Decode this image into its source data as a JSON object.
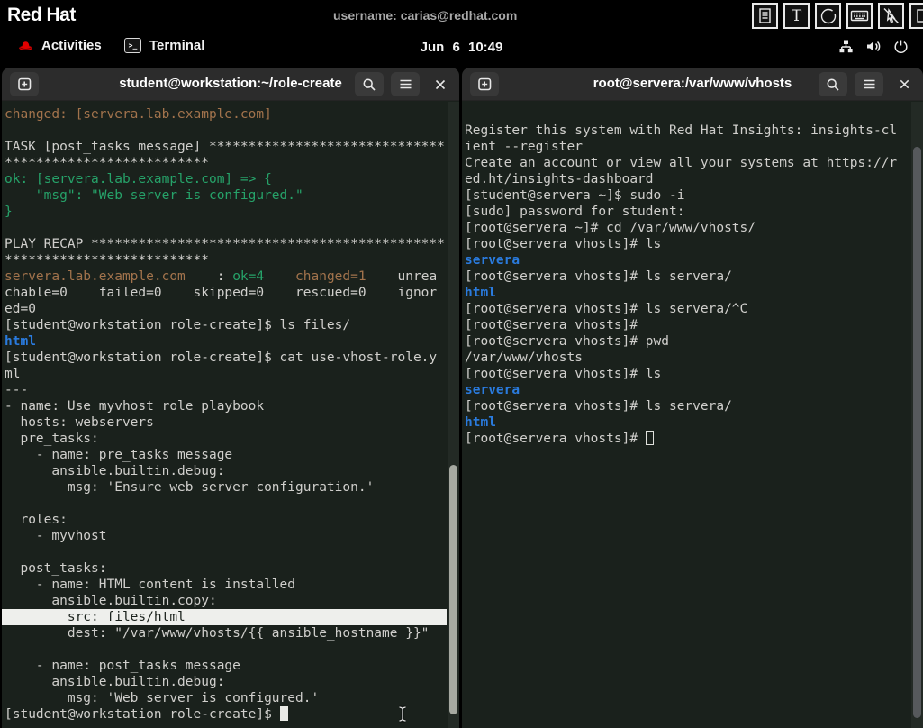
{
  "colors": {
    "terminal_bg": "#1a211c",
    "fg": "#d0cfcc",
    "yellow": "#a2734c",
    "green": "#26a269",
    "blue": "#2a7bde",
    "selection_bg": "#eeefec",
    "selection_fg": "#1a211c",
    "headerbar_bg": "#2c2c2c",
    "topbar_bg": "#000000",
    "redhat_red": "#ee0000"
  },
  "top_bar": {
    "logo": "Red Hat",
    "username": "username: carias@redhat.com",
    "tool_icons": [
      "document-icon",
      "text-icon",
      "circle-icon",
      "keyboard-icon",
      "pointer-disabled-icon",
      "monitor-icon"
    ]
  },
  "gnome_bar": {
    "activities_label": "Activities",
    "app_label": "Terminal",
    "clock": "Jun 6 10:49",
    "status_icons": [
      "network-icon",
      "volume-icon",
      "power-icon"
    ]
  },
  "window_controls": [
    "tab-new-icon",
    "search-icon",
    "menu-icon",
    "close-icon"
  ],
  "left_terminal": {
    "title": "student@workstation:~/role-create",
    "cursor_style": "block",
    "lines": [
      {
        "s": [
          {
            "t": "changed: [servera.lab.example.com]",
            "c": "yellow"
          }
        ]
      },
      {
        "s": []
      },
      {
        "s": [
          {
            "t": "TASK [post_tasks message] ******************************"
          }
        ]
      },
      {
        "s": [
          {
            "t": "**************************"
          }
        ]
      },
      {
        "s": [
          {
            "t": "ok: [servera.lab.example.com] => {",
            "c": "green"
          }
        ]
      },
      {
        "s": [
          {
            "t": "    \"msg\": \"Web server is configured.\"",
            "c": "green"
          }
        ]
      },
      {
        "s": [
          {
            "t": "}",
            "c": "green"
          }
        ]
      },
      {
        "s": []
      },
      {
        "s": [
          {
            "t": "PLAY RECAP *********************************************"
          }
        ]
      },
      {
        "s": [
          {
            "t": "**************************"
          }
        ]
      },
      {
        "s": [
          {
            "t": "servera.lab.example.com",
            "c": "yellow"
          },
          {
            "t": "    : "
          },
          {
            "t": "ok=4",
            "c": "green"
          },
          {
            "t": "    "
          },
          {
            "t": "changed=1",
            "c": "yellow"
          },
          {
            "t": "    unrea"
          }
        ]
      },
      {
        "s": [
          {
            "t": "chable=0    failed=0    skipped=0    rescued=0    ignor"
          }
        ]
      },
      {
        "s": [
          {
            "t": "ed=0"
          }
        ]
      },
      {
        "s": [
          {
            "t": "[student@workstation role-create]$ ls files/"
          }
        ]
      },
      {
        "s": [
          {
            "t": "html",
            "c": "blue"
          }
        ]
      },
      {
        "s": [
          {
            "t": "[student@workstation role-create]$ cat use-vhost-role.y"
          }
        ]
      },
      {
        "s": [
          {
            "t": "ml"
          }
        ]
      },
      {
        "s": [
          {
            "t": "---"
          }
        ]
      },
      {
        "s": [
          {
            "t": "- name: Use myvhost role playbook"
          }
        ]
      },
      {
        "s": [
          {
            "t": "  hosts: webservers"
          }
        ]
      },
      {
        "s": [
          {
            "t": "  pre_tasks:"
          }
        ]
      },
      {
        "s": [
          {
            "t": "    - name: pre_tasks message"
          }
        ]
      },
      {
        "s": [
          {
            "t": "      ansible.builtin.debug:"
          }
        ]
      },
      {
        "s": [
          {
            "t": "        msg: 'Ensure web server configuration.'"
          }
        ]
      },
      {
        "s": []
      },
      {
        "s": [
          {
            "t": "  roles:"
          }
        ]
      },
      {
        "s": [
          {
            "t": "    - myvhost"
          }
        ]
      },
      {
        "s": []
      },
      {
        "s": [
          {
            "t": "  post_tasks:"
          }
        ]
      },
      {
        "s": [
          {
            "t": "    - name: HTML content is installed"
          }
        ]
      },
      {
        "s": [
          {
            "t": "      ansible.builtin.copy:"
          }
        ]
      },
      {
        "s": [
          {
            "t": "        src: files/html"
          }
        ],
        "sel": true
      },
      {
        "s": [
          {
            "t": "        dest: \"/var/www/vhosts/{{ ansible_hostname }}\""
          }
        ]
      },
      {
        "s": []
      },
      {
        "s": [
          {
            "t": "    - name: post_tasks message"
          }
        ]
      },
      {
        "s": [
          {
            "t": "      ansible.builtin.debug:"
          }
        ]
      },
      {
        "s": [
          {
            "t": "        msg: 'Web server is configured.'"
          }
        ]
      },
      {
        "s": [
          {
            "t": "[student@workstation role-create]$ "
          }
        ],
        "cursor": "block"
      }
    ]
  },
  "right_terminal": {
    "title": "root@servera:/var/www/vhosts",
    "cursor_style": "outline",
    "lines": [
      {
        "s": []
      },
      {
        "s": [
          {
            "t": "Register this system with Red Hat Insights: insights-cl"
          }
        ]
      },
      {
        "s": [
          {
            "t": "ient --register"
          }
        ]
      },
      {
        "s": [
          {
            "t": "Create an account or view all your systems at https://r"
          }
        ]
      },
      {
        "s": [
          {
            "t": "ed.ht/insights-dashboard"
          }
        ]
      },
      {
        "s": [
          {
            "t": "[student@servera ~]$ sudo -i"
          }
        ]
      },
      {
        "s": [
          {
            "t": "[sudo] password for student:"
          }
        ]
      },
      {
        "s": [
          {
            "t": "[root@servera ~]# cd /var/www/vhosts/"
          }
        ]
      },
      {
        "s": [
          {
            "t": "[root@servera vhosts]# ls"
          }
        ]
      },
      {
        "s": [
          {
            "t": "servera",
            "c": "blue"
          }
        ]
      },
      {
        "s": [
          {
            "t": "[root@servera vhosts]# ls servera/"
          }
        ]
      },
      {
        "s": [
          {
            "t": "html",
            "c": "blue"
          }
        ]
      },
      {
        "s": [
          {
            "t": "[root@servera vhosts]# ls servera/^C"
          }
        ]
      },
      {
        "s": [
          {
            "t": "[root@servera vhosts]#"
          }
        ]
      },
      {
        "s": [
          {
            "t": "[root@servera vhosts]# pwd"
          }
        ]
      },
      {
        "s": [
          {
            "t": "/var/www/vhosts"
          }
        ]
      },
      {
        "s": [
          {
            "t": "[root@servera vhosts]# ls"
          }
        ]
      },
      {
        "s": [
          {
            "t": "servera",
            "c": "blue"
          }
        ]
      },
      {
        "s": [
          {
            "t": "[root@servera vhosts]# ls servera/"
          }
        ]
      },
      {
        "s": [
          {
            "t": "html",
            "c": "blue"
          }
        ]
      },
      {
        "s": [
          {
            "t": "[root@servera vhosts]# "
          }
        ],
        "cursor": "outline"
      }
    ]
  }
}
